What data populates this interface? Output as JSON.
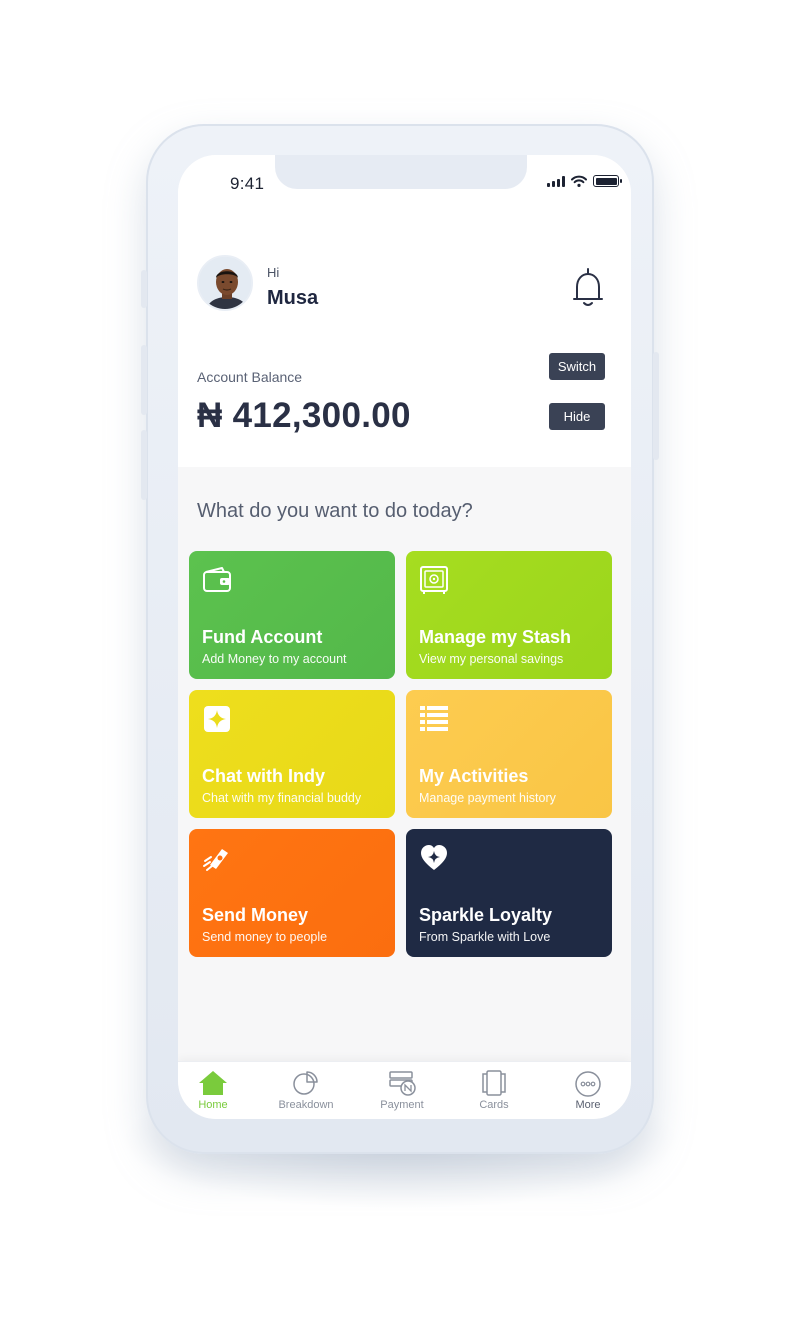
{
  "status_bar": {
    "time": "9:41"
  },
  "header": {
    "greeting": "Hi",
    "user_name": "Musa"
  },
  "balance": {
    "label": "Account Balance",
    "amount": "₦ 412,300.00",
    "switch_label": "Switch",
    "hide_label": "Hide"
  },
  "prompt": "What do you want to do today?",
  "cards": [
    {
      "title": "Fund Account",
      "subtitle": "Add Money to my account",
      "color": "#5ABE4C",
      "icon": "wallet-icon"
    },
    {
      "title": "Manage my Stash",
      "subtitle": "View my personal savings",
      "color": "#A2DB1E",
      "icon": "safe-icon"
    },
    {
      "title": "Chat with Indy",
      "subtitle": "Chat with my financial buddy",
      "color": "#EBDC1B",
      "icon": "sparkle-icon"
    },
    {
      "title": "My Activities",
      "subtitle": "Manage payment history",
      "color": "#FBC94B",
      "icon": "list-icon"
    },
    {
      "title": "Send Money",
      "subtitle": "Send money to people",
      "color": "#FF7211",
      "icon": "send-money-icon"
    },
    {
      "title": "Sparkle Loyalty",
      "subtitle": "From Sparkle with Love",
      "color": "#1F2A44",
      "icon": "heart-sparkle-icon"
    }
  ],
  "tabs": [
    {
      "label": "Home",
      "icon": "home-icon",
      "active": true
    },
    {
      "label": "Breakdown",
      "icon": "pie-chart-icon",
      "active": false
    },
    {
      "label": "Payment",
      "icon": "payment-icon",
      "active": false
    },
    {
      "label": "Cards",
      "icon": "cards-icon",
      "active": false
    },
    {
      "label": "More",
      "icon": "more-icon",
      "active": false
    }
  ],
  "colors": {
    "active_tab": "#7ACB3C",
    "inactive_tab": "#8A909C",
    "dark_button": "#3A4255"
  }
}
